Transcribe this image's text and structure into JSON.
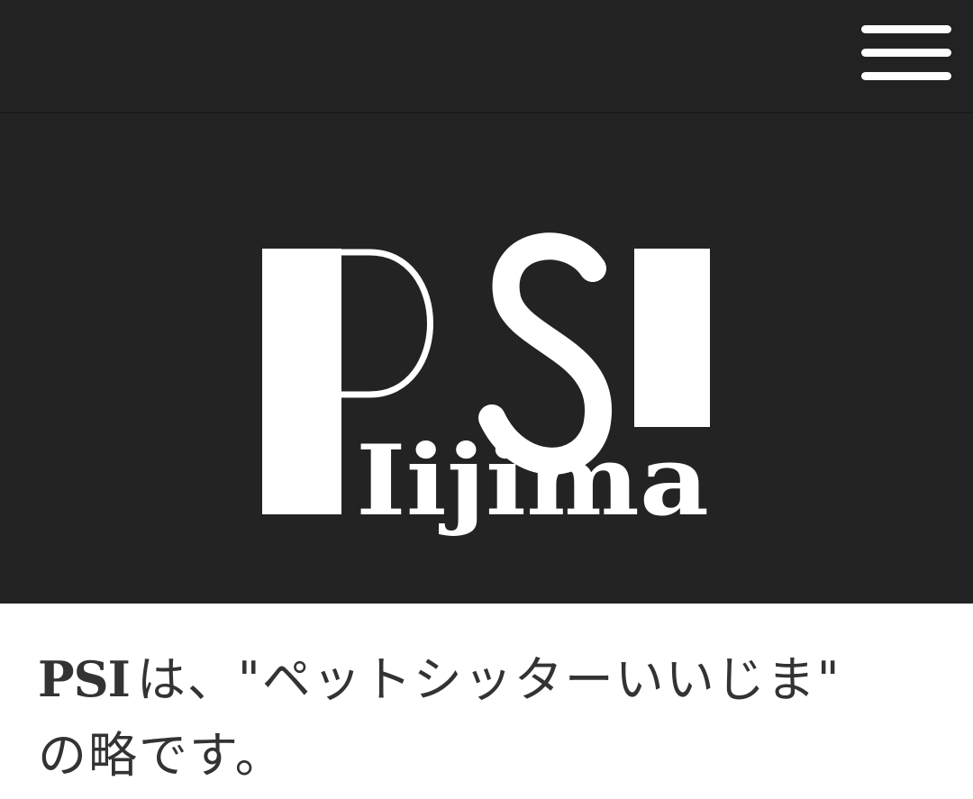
{
  "header": {
    "menu_icon": "hamburger-menu-icon",
    "background": "#222222"
  },
  "hero": {
    "background": "#232323",
    "logo": {
      "mark_text": "PSI",
      "sub_text": "Iijima",
      "color": "#ffffff"
    }
  },
  "content": {
    "intro_abbr": "PSI",
    "intro_text": "は、\"ペットシッターいいじま\" の略です。",
    "text_color": "#333333"
  }
}
